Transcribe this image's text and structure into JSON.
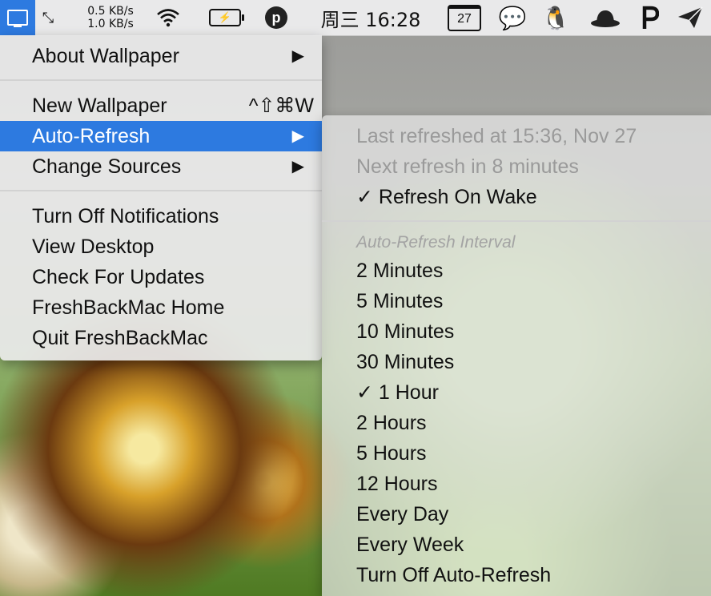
{
  "menubar": {
    "app_icon": "display-icon",
    "net_up": "0.5 KB/s",
    "net_down": "1.0 KB/s",
    "clock": "周三 16:28",
    "calendar_day": "27",
    "p_badge": "p"
  },
  "menu": {
    "about": "About Wallpaper",
    "new_wallpaper": "New Wallpaper",
    "new_wallpaper_shortcut": "^⇧⌘W",
    "auto_refresh": "Auto-Refresh",
    "change_sources": "Change Sources",
    "turn_off_notifications": "Turn Off Notifications",
    "view_desktop": "View Desktop",
    "check_updates": "Check For Updates",
    "home": "FreshBackMac Home",
    "quit": "Quit FreshBackMac"
  },
  "submenu": {
    "last_refreshed": "Last refreshed at 15:36, Nov 27",
    "next_refresh": "Next refresh in 8 minutes",
    "refresh_on_wake": "✓ Refresh On Wake",
    "interval_header": "Auto-Refresh Interval",
    "intervals": [
      "2 Minutes",
      "5 Minutes",
      "10 Minutes",
      "30 Minutes",
      "✓ 1 Hour",
      "2 Hours",
      "5 Hours",
      "12 Hours",
      "Every Day",
      "Every Week",
      "Turn Off Auto-Refresh"
    ]
  },
  "colors": {
    "accent": "#2d7ae0"
  }
}
